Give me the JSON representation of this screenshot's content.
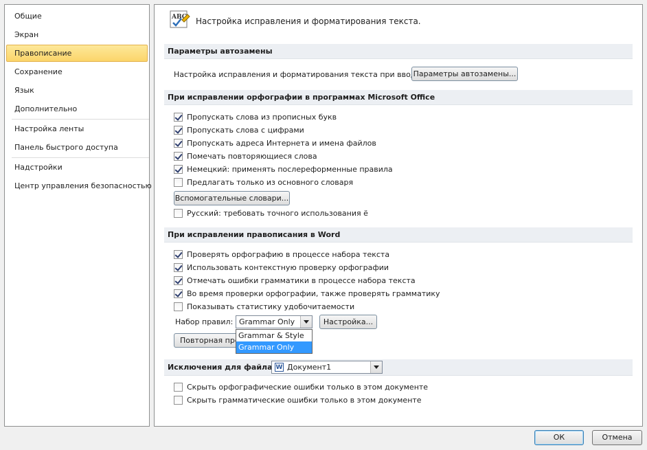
{
  "sidebar": {
    "items": [
      {
        "label": "Общие"
      },
      {
        "label": "Экран"
      },
      {
        "label": "Правописание",
        "selected": true
      },
      {
        "label": "Сохранение"
      },
      {
        "label": "Язык"
      },
      {
        "label": "Дополнительно"
      },
      {
        "label": "Настройка ленты"
      },
      {
        "label": "Панель быстрого доступа"
      },
      {
        "label": "Надстройки"
      },
      {
        "label": "Центр управления безопасностью"
      }
    ]
  },
  "header": {
    "icon": "abc-spellcheck-icon",
    "title": "Настройка исправления и форматирования текста."
  },
  "autocorrect": {
    "section_title": "Параметры автозамены",
    "row_label": "Настройка исправления и форматирования текста при вводе:",
    "button_label": "Параметры автозамены..."
  },
  "office_spelling": {
    "section_title": "При исправлении орфографии в программах Microsoft Office",
    "options": [
      {
        "label": "Пропускать слова из прописных букв",
        "checked": true
      },
      {
        "label": "Пропускать слова с цифрами",
        "checked": true
      },
      {
        "label": "Пропускать адреса Интернета и имена файлов",
        "checked": true
      },
      {
        "label": "Помечать повторяющиеся слова",
        "checked": true
      },
      {
        "label": "Немецкий: применять послереформенные правила",
        "checked": true
      },
      {
        "label": "Предлагать только из основного словаря",
        "checked": false
      }
    ],
    "custom_dict_button": "Вспомогательные словари...",
    "russian_option": {
      "label": "Русский: требовать точного использования ё",
      "checked": false
    }
  },
  "word_spelling": {
    "section_title": "При исправлении правописания в Word",
    "options": [
      {
        "label": "Проверять орфографию в процессе набора текста",
        "checked": true
      },
      {
        "label": "Использовать контекстную проверку орфографии",
        "checked": true
      },
      {
        "label": "Отмечать ошибки грамматики в процессе набора текста",
        "checked": true
      },
      {
        "label": "Во время проверки орфографии, также проверять грамматику",
        "checked": true
      },
      {
        "label": "Показывать статистику удобочитаемости",
        "checked": false
      }
    ],
    "ruleset_label": "Набор правил:",
    "ruleset_value": "Grammar Only",
    "ruleset_options": [
      "Grammar & Style",
      "Grammar Only"
    ],
    "settings_button": "Настройка...",
    "recheck_button": "Повторная про"
  },
  "exceptions": {
    "section_title": "Исключения для файла:",
    "document_value": "Документ1",
    "options": [
      {
        "label": "Скрыть орфографические ошибки только в этом документе",
        "checked": false
      },
      {
        "label": "Скрыть грамматические ошибки только в этом документе",
        "checked": false
      }
    ]
  },
  "footer": {
    "ok_label": "ОК",
    "cancel_label": "Отмена"
  }
}
